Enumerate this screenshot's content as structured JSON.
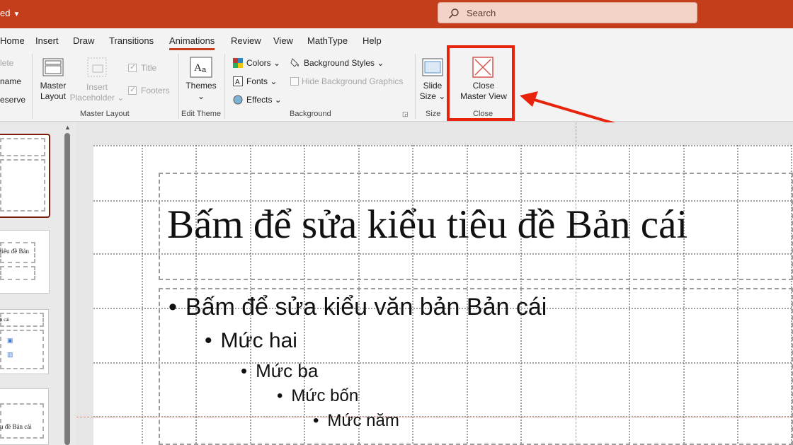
{
  "titlebar": {
    "doc_name": "ed",
    "search_placeholder": "Search"
  },
  "tabs": [
    "Home",
    "Insert",
    "Draw",
    "Transitions",
    "Animations",
    "Review",
    "View",
    "MathType",
    "Help"
  ],
  "active_tab": "Animations",
  "ribbon": {
    "edit_master": {
      "delete": "lete",
      "rename": "name",
      "preserve": "eserve"
    },
    "master_layout": {
      "master_layout_line1": "Master",
      "master_layout_line2": "Layout",
      "insert_line1": "Insert",
      "insert_line2": "Placeholder",
      "title_check": "Title",
      "footers_check": "Footers",
      "group_label": "Master Layout"
    },
    "edit_theme": {
      "themes": "Themes",
      "group_label": "Edit Theme"
    },
    "background": {
      "colors": "Colors",
      "fonts": "Fonts",
      "effects": "Effects",
      "background_styles": "Background Styles",
      "hide_bg": "Hide Background Graphics",
      "group_label": "Background"
    },
    "size": {
      "slide": "Slide",
      "size": "Size",
      "group_label": "Size"
    },
    "close": {
      "close": "Close",
      "master_view": "Master View",
      "group_label": "Close"
    },
    "colors": {
      "accent": "#c43e1c",
      "highlight": "#e8230b"
    }
  },
  "thumbnails": [
    {
      "text": ""
    },
    {
      "text": "tiêu đề Bản"
    },
    {
      "text": "n cái"
    },
    {
      "text": "u đề Bản cái"
    }
  ],
  "slide": {
    "title": "Bấm để sửa kiểu tiêu đề Bản cái",
    "levels": [
      "Bấm để sửa kiểu văn bản Bản cái",
      "Mức hai",
      "Mức ba",
      "Mức bốn",
      "Mức năm"
    ],
    "bullet": "•"
  }
}
